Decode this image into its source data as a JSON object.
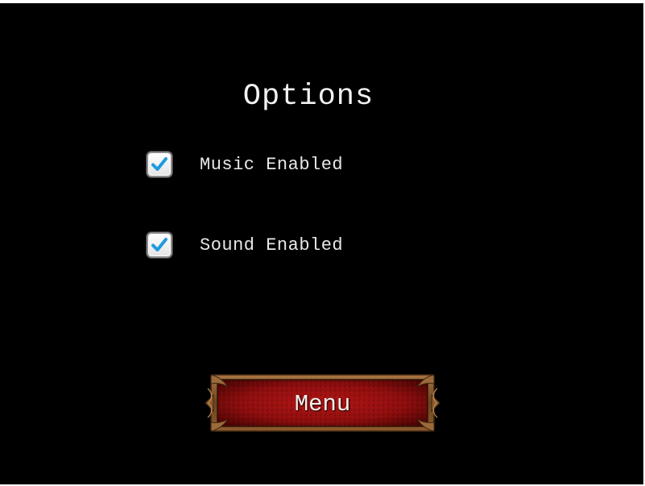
{
  "screen": {
    "title": "Options",
    "background": "#000000"
  },
  "options": [
    {
      "label": "Music Enabled",
      "checked": true,
      "icon": "checkmark-icon"
    },
    {
      "label": "Sound Enabled",
      "checked": true,
      "icon": "checkmark-icon"
    }
  ],
  "menu_button": {
    "label": "Menu",
    "frame_color": "#8a5a2e",
    "fill_color": "#9a1010"
  },
  "colors": {
    "text": "#f2f2f2",
    "check": "#1e9be0"
  }
}
